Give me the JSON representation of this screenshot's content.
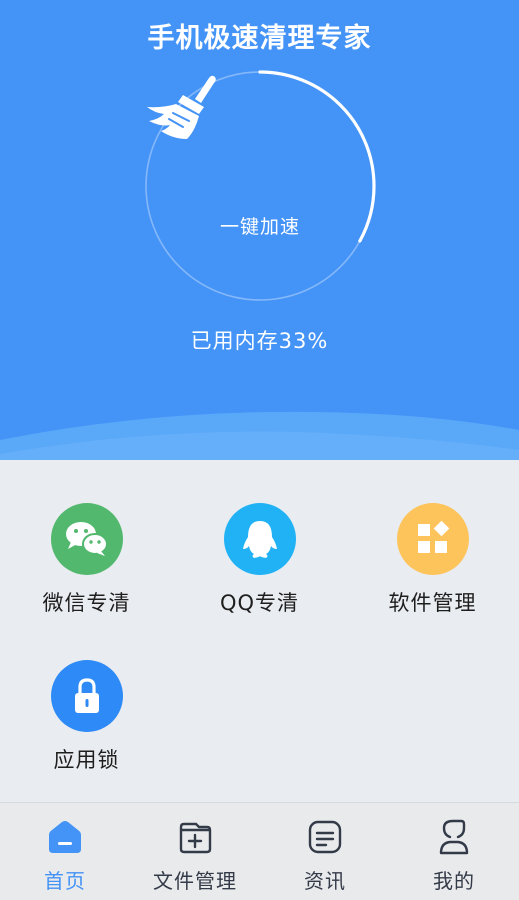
{
  "header": {
    "title": "手机极速清理专家"
  },
  "cleaner": {
    "button_label": "一键加速",
    "memory_text": "已用内存33%",
    "memory_used_percent": 33,
    "icon": "broom-icon"
  },
  "features": [
    {
      "label": "微信专清",
      "icon": "wechat-icon",
      "color": "#52b86e"
    },
    {
      "label": "QQ专清",
      "icon": "qq-penguin-icon",
      "color": "#21b1f5"
    },
    {
      "label": "软件管理",
      "icon": "apps-grid-icon",
      "color": "#fdc45c"
    },
    {
      "label": "应用锁",
      "icon": "lock-icon",
      "color": "#2e8af6"
    }
  ],
  "nav": {
    "items": [
      {
        "label": "首页",
        "icon": "home-icon",
        "active": true
      },
      {
        "label": "文件管理",
        "icon": "folder-add-icon",
        "active": false
      },
      {
        "label": "资讯",
        "icon": "news-icon",
        "active": false
      },
      {
        "label": "我的",
        "icon": "profile-icon",
        "active": false
      }
    ]
  },
  "colors": {
    "primary": "#4493f7",
    "active_nav": "#4493f7",
    "background": "#e9ecf0"
  }
}
